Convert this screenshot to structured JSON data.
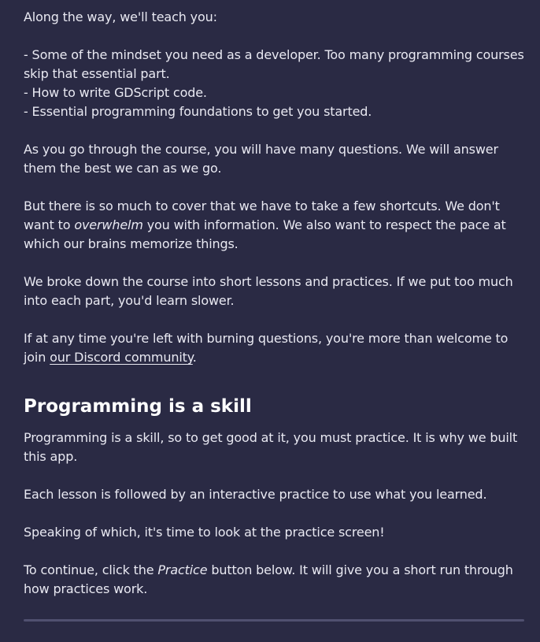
{
  "lesson": {
    "intro": "Along the way, we'll teach you:",
    "bullets": [
      "- Some of the mindset you need as a developer. Too many programming courses skip that essential part.",
      "- How to write GDScript code.",
      "- Essential programming foundations to get you started."
    ],
    "questions": "As you go through the course, you will have many questions. We will answer them the best we can as we go.",
    "shortcuts_before": "But there is so much to cover that we have to take a few shortcuts. We don't want to ",
    "shortcuts_em": "overwhelm",
    "shortcuts_after": " you with information. We also want to respect the pace at which our brains memorize things.",
    "breakdown": "We broke down the course into short lessons and practices. If we put too much into each part, you'd learn slower.",
    "discord_before": "If at any time you're left with burning questions, you're more than welcome to join ",
    "discord_link": "our Discord community",
    "discord_after": ".",
    "section_heading": "Programming is a skill",
    "skill": "Programming is a skill, so to get good at it, you must practice. It is why we built this app.",
    "followed": "Each lesson is followed by an interactive practice to use what you learned.",
    "speaking": "Speaking of which, it's time to look at the practice screen!",
    "continue_before": "To continue, click the ",
    "continue_em": "Practice",
    "continue_after": " button below. It will give you a short run through how practices work."
  }
}
